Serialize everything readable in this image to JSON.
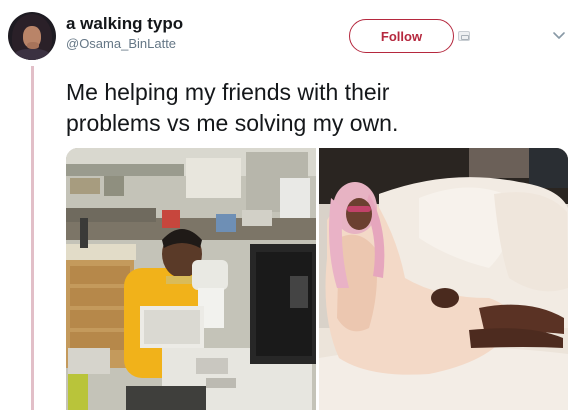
{
  "user": {
    "display_name": "a walking typo",
    "handle": "@Osama_BinLatte"
  },
  "actions": {
    "follow_label": "Follow"
  },
  "tweet": {
    "text_line1": "Me helping my friends with their",
    "text_line2": "problems vs me solving my own."
  },
  "icons": {
    "follow_button": "follow-button",
    "overflow": "chevron-down-icon",
    "card": "card-icon"
  },
  "colors": {
    "accent": "#b5283e",
    "thread_line": "#e2bfc8",
    "secondary_text": "#657786"
  }
}
